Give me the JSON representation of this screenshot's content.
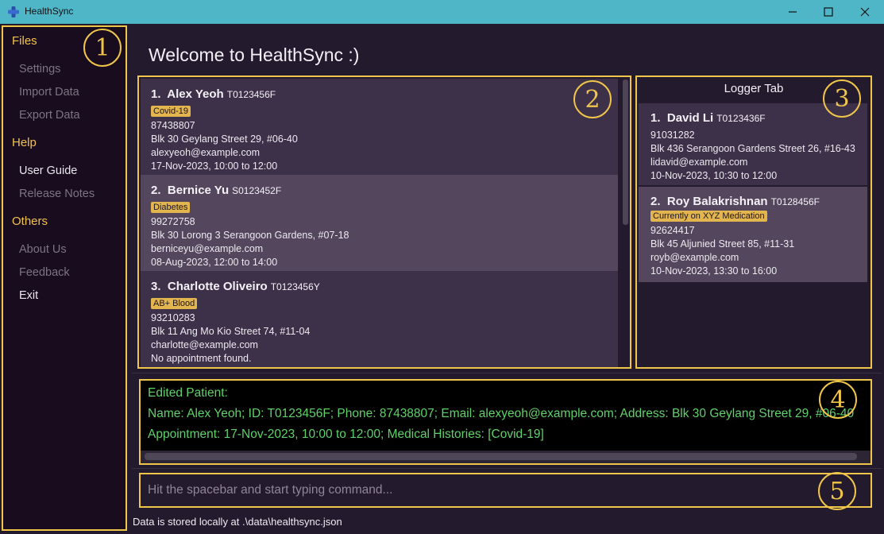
{
  "window": {
    "title": "HealthSync"
  },
  "sidebar": {
    "sections": [
      {
        "label": "Files",
        "items": [
          "Settings",
          "Import Data",
          "Export Data"
        ]
      },
      {
        "label": "Help",
        "items": [
          "User Guide",
          "Release Notes"
        ]
      },
      {
        "label": "Others",
        "items": [
          "About Us",
          "Feedback",
          "Exit"
        ]
      }
    ]
  },
  "annotations": [
    "1",
    "2",
    "3",
    "4",
    "5"
  ],
  "welcome": "Welcome to HealthSync :)",
  "patients": [
    {
      "index": "1.",
      "name": "Alex Yeoh",
      "id": "T0123456F",
      "tag": "Covid-19",
      "phone": "87438807",
      "address": "Blk 30 Geylang Street 29, #06-40",
      "email": "alexyeoh@example.com",
      "appointment": "17-Nov-2023, 10:00 to 12:00"
    },
    {
      "index": "2.",
      "name": "Bernice Yu",
      "id": "S0123452F",
      "tag": "Diabetes",
      "phone": "99272758",
      "address": "Blk 30 Lorong 3 Serangoon Gardens, #07-18",
      "email": "berniceyu@example.com",
      "appointment": "08-Aug-2023, 12:00 to 14:00"
    },
    {
      "index": "3.",
      "name": "Charlotte Oliveiro",
      "id": "T0123456Y",
      "tag": "AB+ Blood",
      "phone": "93210283",
      "address": "Blk 11 Ang Mo Kio Street 74, #11-04",
      "email": "charlotte@example.com",
      "appointment": "No appointment found."
    }
  ],
  "logger": {
    "title": "Logger Tab",
    "entries": [
      {
        "index": "1.",
        "name": "David Li",
        "id": "T0123436F",
        "tag": "",
        "phone": "91031282",
        "address": "Blk 436 Serangoon Gardens Street 26, #16-43",
        "email": "lidavid@example.com",
        "appointment": "10-Nov-2023, 10:30 to 12:00"
      },
      {
        "index": "2.",
        "name": "Roy Balakrishnan",
        "id": "T0128456F",
        "tag": "Currently on XYZ Medication",
        "phone": "92624417",
        "address": "Blk 45 Aljunied Street 85, #11-31",
        "email": "royb@example.com",
        "appointment": "10-Nov-2023, 13:30 to 16:00"
      }
    ]
  },
  "result": {
    "lines": [
      "Edited Patient:",
      "Name: Alex Yeoh; ID: T0123456F; Phone: 87438807; Email: alexyeoh@example.com; Address: Blk 30 Geylang Street 29, #06-40",
      "Appointment: 17-Nov-2023, 10:00 to 12:00; Medical Histories: [Covid-19]"
    ]
  },
  "command": {
    "placeholder": "Hit the spacebar and start typing command...",
    "value": ""
  },
  "status": "Data is stored locally at .\\data\\healthsync.json",
  "colors": {
    "accent": "#f0c64a",
    "background": "#231a2e",
    "titlebar": "#4fb6c8",
    "tag": "#e3b54e",
    "result_text": "#5fd16a"
  }
}
